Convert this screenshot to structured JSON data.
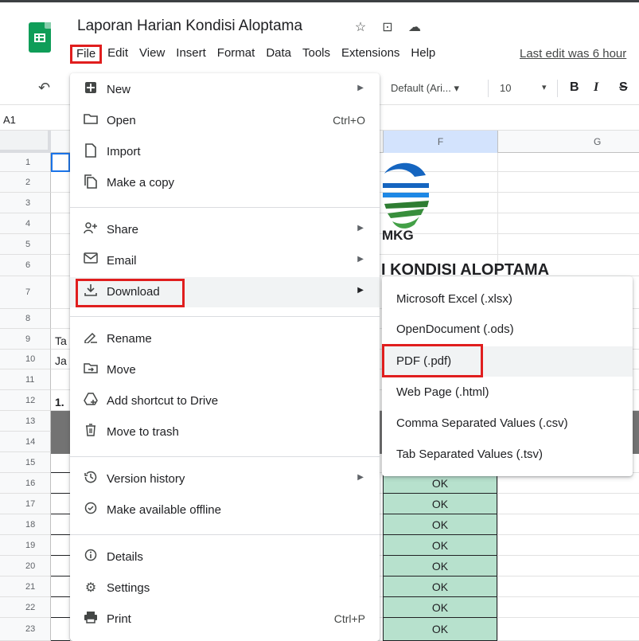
{
  "doc": {
    "title": "Laporan Harian Kondisi Aloptama",
    "icons": [
      "star-icon",
      "move-to-folder-icon",
      "cloud-status-icon"
    ]
  },
  "menubar": {
    "items": [
      "File",
      "Edit",
      "View",
      "Insert",
      "Format",
      "Data",
      "Tools",
      "Extensions",
      "Help"
    ],
    "last_edit": "Last edit was 6 hour"
  },
  "toolbar": {
    "font": "Default (Ari...",
    "font_size": "10",
    "bold": "B",
    "italic": "I",
    "strike": "S"
  },
  "formula": {
    "cell_ref": "A1"
  },
  "grid": {
    "columns": [
      "F",
      "G"
    ],
    "rows": [
      "1",
      "2",
      "3",
      "4",
      "5",
      "6",
      "7",
      "8",
      "9",
      "10",
      "11",
      "12",
      "13",
      "14",
      "15",
      "16",
      "17",
      "18",
      "19",
      "20",
      "21",
      "22",
      "23"
    ],
    "peek_cells": {
      "r9": "Ta",
      "r10": "Ja",
      "r12": "1."
    },
    "logo_text": "MKG",
    "heading": "I KONDISI ALOPTAMA",
    "ok_values": [
      "OK",
      "OK",
      "OK",
      "OK",
      "OK",
      "OK",
      "OK",
      "OK"
    ]
  },
  "file_menu": {
    "items": [
      {
        "label": "New",
        "icon": "new-sheet-icon",
        "arrow": true
      },
      {
        "label": "Open",
        "icon": "folder-open-icon",
        "shortcut": "Ctrl+O"
      },
      {
        "label": "Import",
        "icon": "import-icon"
      },
      {
        "label": "Make a copy",
        "icon": "copy-icon"
      },
      {
        "label": "Share",
        "icon": "share-person-icon",
        "arrow": true
      },
      {
        "label": "Email",
        "icon": "email-icon",
        "arrow": true
      },
      {
        "label": "Download",
        "icon": "download-icon",
        "arrow": true,
        "highlighted": true
      },
      {
        "label": "Rename",
        "icon": "rename-icon"
      },
      {
        "label": "Move",
        "icon": "move-icon"
      },
      {
        "label": "Add shortcut to Drive",
        "icon": "drive-shortcut-icon"
      },
      {
        "label": "Move to trash",
        "icon": "trash-icon"
      },
      {
        "label": "Version history",
        "icon": "history-icon",
        "arrow": true
      },
      {
        "label": "Make available offline",
        "icon": "offline-icon"
      },
      {
        "label": "Details",
        "icon": "info-icon"
      },
      {
        "label": "Settings",
        "icon": "settings-icon"
      },
      {
        "label": "Print",
        "icon": "print-icon",
        "shortcut": "Ctrl+P"
      }
    ]
  },
  "download_menu": {
    "items": [
      {
        "label": "Microsoft Excel (.xlsx)"
      },
      {
        "label": "OpenDocument (.ods)"
      },
      {
        "label": "PDF (.pdf)",
        "highlighted": true
      },
      {
        "label": "Web Page (.html)"
      },
      {
        "label": "Comma Separated Values (.csv)"
      },
      {
        "label": "Tab Separated Values (.tsv)"
      }
    ]
  },
  "colors": {
    "highlight_box": "#e01e1e",
    "ok_fill": "#b7e1cd",
    "sheets_green": "#0f9d58"
  }
}
